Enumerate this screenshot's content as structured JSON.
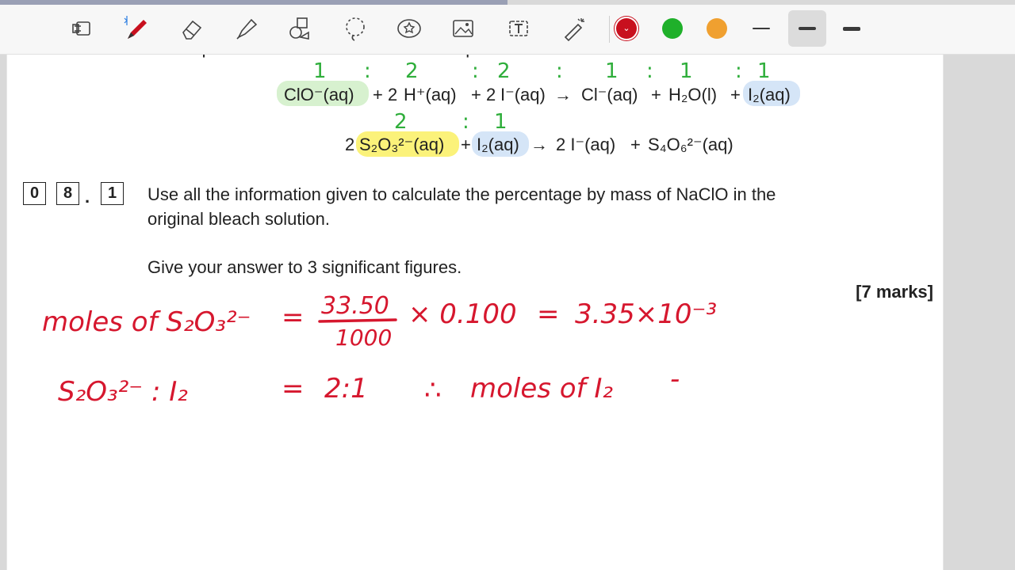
{
  "toolbar": {
    "tools": [
      {
        "name": "lasso-tool"
      },
      {
        "name": "pen-tool",
        "badge": "bluetooth"
      },
      {
        "name": "eraser-tool"
      },
      {
        "name": "highlighter-tool"
      },
      {
        "name": "shapes-tool"
      },
      {
        "name": "lasso-select-tool"
      },
      {
        "name": "sticker-tool"
      },
      {
        "name": "image-tool"
      },
      {
        "name": "text-tool"
      },
      {
        "name": "laser-pointer-tool"
      }
    ],
    "colors": [
      "#c8101e",
      "#1fb02a",
      "#f0a030"
    ],
    "selected_color": "#c8101e",
    "line_weights": [
      "thin",
      "medium",
      "thick"
    ],
    "selected_weight": "medium"
  },
  "document": {
    "clipped_header": "The equations for the reactions in this experiment are",
    "equation1": {
      "reactant1": "ClO⁻(aq)",
      "plus1": "+ 2",
      "reactant2": "H⁺(aq)",
      "plus2": "+ 2",
      "reactant3": "I⁻(aq)",
      "arrow": "→",
      "product1": "Cl⁻(aq)",
      "plus3": "+",
      "product2": "H₂O(l)",
      "plus4": "+",
      "product3": "I₂(aq)"
    },
    "equation2": {
      "coef": "2",
      "reactant1": "S₂O₃²⁻(aq)",
      "plus1": "+",
      "reactant2": "I₂(aq)",
      "arrow": "→",
      "product1": "2 I⁻(aq)",
      "plus2": "+",
      "product2": "S₄O₆²⁻(aq)"
    },
    "question_number": [
      "0",
      "8",
      "1"
    ],
    "question_text_line1": "Use all the information given to calculate the percentage by mass of NaClO in the",
    "question_text_line2": "original bleach solution.",
    "instruction": "Give your answer to 3 significant figures.",
    "marks": "[7 marks]"
  },
  "annotations": {
    "green_ratio1": [
      "1",
      ":",
      "2",
      ":",
      "2",
      ":",
      "1",
      ":",
      "1",
      ":",
      "1"
    ],
    "green_ratio2": [
      "2",
      ":",
      "1"
    ],
    "line1_label": "moles of S₂O₃²⁻",
    "line1_equals": "=",
    "line1_numerator": "33.50",
    "line1_denominator": "1000",
    "line1_times": "× 0.100",
    "line1_equals2": "=",
    "line1_result": "3.35×10⁻³",
    "line2_left": "S₂O₃²⁻ : I₂",
    "line2_equals": "=",
    "line2_ratio": "2:1",
    "line2_therefore": "∴",
    "line2_right": "moles of I₂",
    "line2_dash": "-"
  }
}
